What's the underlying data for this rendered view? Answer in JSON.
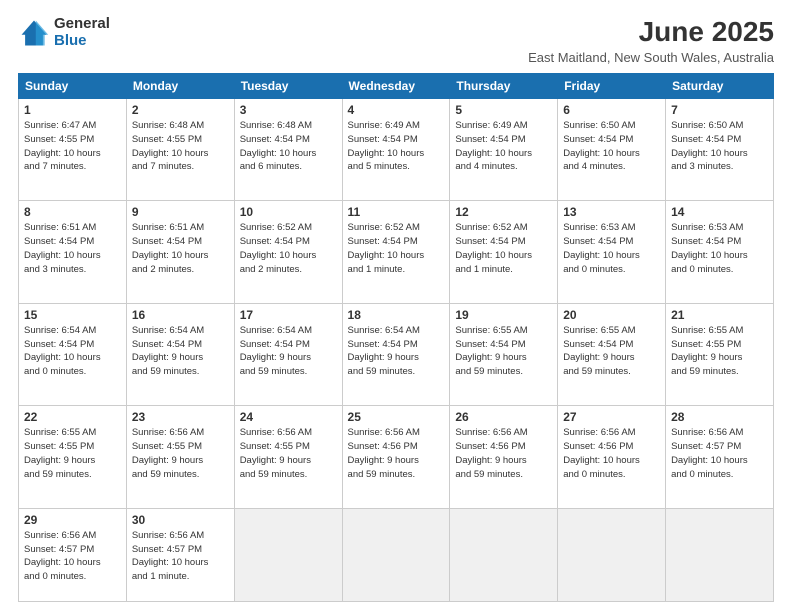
{
  "header": {
    "logo_general": "General",
    "logo_blue": "Blue",
    "title": "June 2025",
    "subtitle": "East Maitland, New South Wales, Australia"
  },
  "weekdays": [
    "Sunday",
    "Monday",
    "Tuesday",
    "Wednesday",
    "Thursday",
    "Friday",
    "Saturday"
  ],
  "weeks": [
    [
      {
        "day": "1",
        "info": "Sunrise: 6:47 AM\nSunset: 4:55 PM\nDaylight: 10 hours\nand 7 minutes."
      },
      {
        "day": "2",
        "info": "Sunrise: 6:48 AM\nSunset: 4:55 PM\nDaylight: 10 hours\nand 7 minutes."
      },
      {
        "day": "3",
        "info": "Sunrise: 6:48 AM\nSunset: 4:54 PM\nDaylight: 10 hours\nand 6 minutes."
      },
      {
        "day": "4",
        "info": "Sunrise: 6:49 AM\nSunset: 4:54 PM\nDaylight: 10 hours\nand 5 minutes."
      },
      {
        "day": "5",
        "info": "Sunrise: 6:49 AM\nSunset: 4:54 PM\nDaylight: 10 hours\nand 4 minutes."
      },
      {
        "day": "6",
        "info": "Sunrise: 6:50 AM\nSunset: 4:54 PM\nDaylight: 10 hours\nand 4 minutes."
      },
      {
        "day": "7",
        "info": "Sunrise: 6:50 AM\nSunset: 4:54 PM\nDaylight: 10 hours\nand 3 minutes."
      }
    ],
    [
      {
        "day": "8",
        "info": "Sunrise: 6:51 AM\nSunset: 4:54 PM\nDaylight: 10 hours\nand 3 minutes."
      },
      {
        "day": "9",
        "info": "Sunrise: 6:51 AM\nSunset: 4:54 PM\nDaylight: 10 hours\nand 2 minutes."
      },
      {
        "day": "10",
        "info": "Sunrise: 6:52 AM\nSunset: 4:54 PM\nDaylight: 10 hours\nand 2 minutes."
      },
      {
        "day": "11",
        "info": "Sunrise: 6:52 AM\nSunset: 4:54 PM\nDaylight: 10 hours\nand 1 minute."
      },
      {
        "day": "12",
        "info": "Sunrise: 6:52 AM\nSunset: 4:54 PM\nDaylight: 10 hours\nand 1 minute."
      },
      {
        "day": "13",
        "info": "Sunrise: 6:53 AM\nSunset: 4:54 PM\nDaylight: 10 hours\nand 0 minutes."
      },
      {
        "day": "14",
        "info": "Sunrise: 6:53 AM\nSunset: 4:54 PM\nDaylight: 10 hours\nand 0 minutes."
      }
    ],
    [
      {
        "day": "15",
        "info": "Sunrise: 6:54 AM\nSunset: 4:54 PM\nDaylight: 10 hours\nand 0 minutes."
      },
      {
        "day": "16",
        "info": "Sunrise: 6:54 AM\nSunset: 4:54 PM\nDaylight: 9 hours\nand 59 minutes."
      },
      {
        "day": "17",
        "info": "Sunrise: 6:54 AM\nSunset: 4:54 PM\nDaylight: 9 hours\nand 59 minutes."
      },
      {
        "day": "18",
        "info": "Sunrise: 6:54 AM\nSunset: 4:54 PM\nDaylight: 9 hours\nand 59 minutes."
      },
      {
        "day": "19",
        "info": "Sunrise: 6:55 AM\nSunset: 4:54 PM\nDaylight: 9 hours\nand 59 minutes."
      },
      {
        "day": "20",
        "info": "Sunrise: 6:55 AM\nSunset: 4:54 PM\nDaylight: 9 hours\nand 59 minutes."
      },
      {
        "day": "21",
        "info": "Sunrise: 6:55 AM\nSunset: 4:55 PM\nDaylight: 9 hours\nand 59 minutes."
      }
    ],
    [
      {
        "day": "22",
        "info": "Sunrise: 6:55 AM\nSunset: 4:55 PM\nDaylight: 9 hours\nand 59 minutes."
      },
      {
        "day": "23",
        "info": "Sunrise: 6:56 AM\nSunset: 4:55 PM\nDaylight: 9 hours\nand 59 minutes."
      },
      {
        "day": "24",
        "info": "Sunrise: 6:56 AM\nSunset: 4:55 PM\nDaylight: 9 hours\nand 59 minutes."
      },
      {
        "day": "25",
        "info": "Sunrise: 6:56 AM\nSunset: 4:56 PM\nDaylight: 9 hours\nand 59 minutes."
      },
      {
        "day": "26",
        "info": "Sunrise: 6:56 AM\nSunset: 4:56 PM\nDaylight: 9 hours\nand 59 minutes."
      },
      {
        "day": "27",
        "info": "Sunrise: 6:56 AM\nSunset: 4:56 PM\nDaylight: 10 hours\nand 0 minutes."
      },
      {
        "day": "28",
        "info": "Sunrise: 6:56 AM\nSunset: 4:57 PM\nDaylight: 10 hours\nand 0 minutes."
      }
    ],
    [
      {
        "day": "29",
        "info": "Sunrise: 6:56 AM\nSunset: 4:57 PM\nDaylight: 10 hours\nand 0 minutes."
      },
      {
        "day": "30",
        "info": "Sunrise: 6:56 AM\nSunset: 4:57 PM\nDaylight: 10 hours\nand 1 minute."
      },
      {
        "day": "",
        "info": ""
      },
      {
        "day": "",
        "info": ""
      },
      {
        "day": "",
        "info": ""
      },
      {
        "day": "",
        "info": ""
      },
      {
        "day": "",
        "info": ""
      }
    ]
  ]
}
